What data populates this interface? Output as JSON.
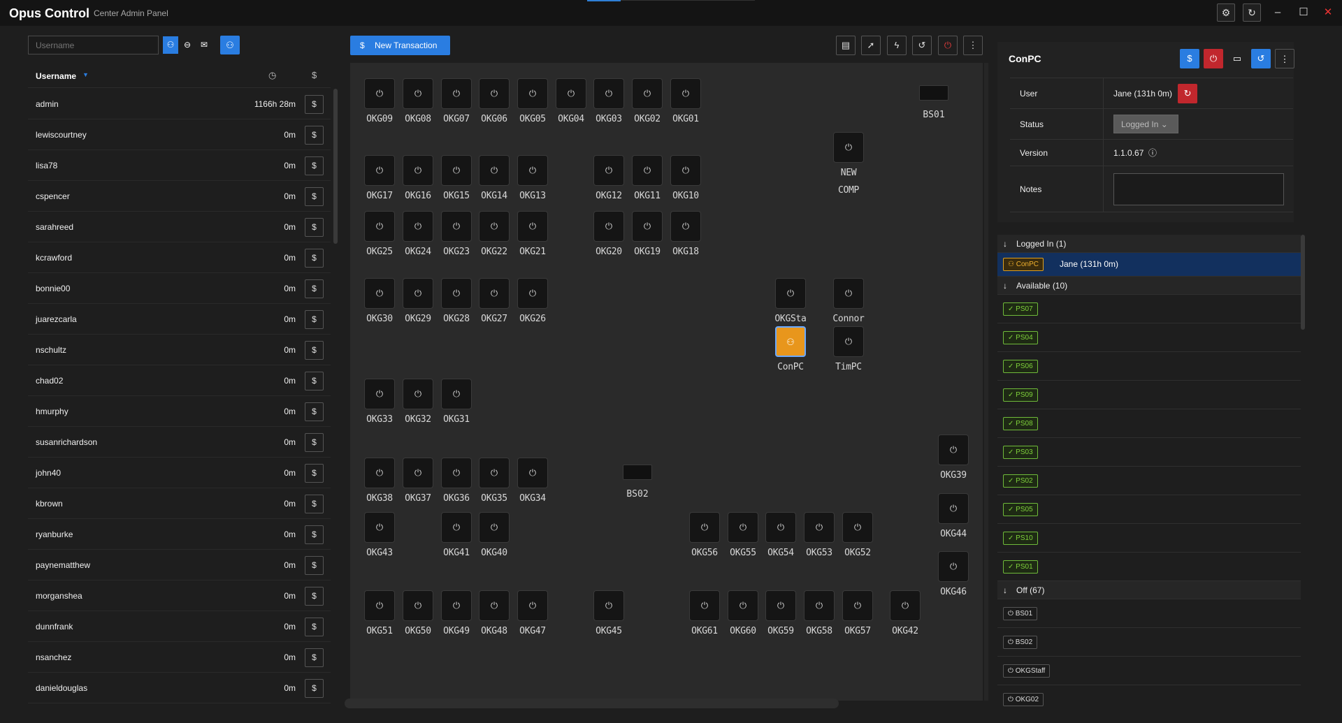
{
  "app": {
    "title": "Opus Control",
    "subtitle": "Center Admin Panel"
  },
  "left": {
    "search_placeholder": "Username",
    "header_label": "Username",
    "users": [
      {
        "name": "admin",
        "time": "1166h 28m"
      },
      {
        "name": "lewiscourtney",
        "time": "0m"
      },
      {
        "name": "lisa78",
        "time": "0m"
      },
      {
        "name": "cspencer",
        "time": "0m"
      },
      {
        "name": "sarahreed",
        "time": "0m"
      },
      {
        "name": "kcrawford",
        "time": "0m"
      },
      {
        "name": "bonnie00",
        "time": "0m"
      },
      {
        "name": "juarezcarla",
        "time": "0m"
      },
      {
        "name": "nschultz",
        "time": "0m"
      },
      {
        "name": "chad02",
        "time": "0m"
      },
      {
        "name": "hmurphy",
        "time": "0m"
      },
      {
        "name": "susanrichardson",
        "time": "0m"
      },
      {
        "name": "john40",
        "time": "0m"
      },
      {
        "name": "kbrown",
        "time": "0m"
      },
      {
        "name": "ryanburke",
        "time": "0m"
      },
      {
        "name": "paynematthew",
        "time": "0m"
      },
      {
        "name": "morganshea",
        "time": "0m"
      },
      {
        "name": "dunnfrank",
        "time": "0m"
      },
      {
        "name": "nsanchez",
        "time": "0m"
      },
      {
        "name": "danieldouglas",
        "time": "0m"
      }
    ]
  },
  "toolbar": {
    "new_transaction": "New Transaction"
  },
  "map": {
    "computers": [
      {
        "label": "OKG09"
      },
      {
        "label": "OKG08"
      },
      {
        "label": "OKG07"
      },
      {
        "label": "OKG06"
      },
      {
        "label": "OKG05"
      },
      {
        "label": "OKG04"
      },
      {
        "label": "OKG03"
      },
      {
        "label": "OKG02"
      },
      {
        "label": "OKG01"
      },
      {
        "label": "OKG17"
      },
      {
        "label": "OKG16"
      },
      {
        "label": "OKG15"
      },
      {
        "label": "OKG14"
      },
      {
        "label": "OKG13"
      },
      {
        "label": "OKG12"
      },
      {
        "label": "OKG11"
      },
      {
        "label": "OKG10"
      },
      {
        "label": "OKG25"
      },
      {
        "label": "OKG24"
      },
      {
        "label": "OKG23"
      },
      {
        "label": "OKG22"
      },
      {
        "label": "OKG21"
      },
      {
        "label": "OKG20"
      },
      {
        "label": "OKG19"
      },
      {
        "label": "OKG18"
      },
      {
        "label": "OKG30"
      },
      {
        "label": "OKG29"
      },
      {
        "label": "OKG28"
      },
      {
        "label": "OKG27"
      },
      {
        "label": "OKG26"
      },
      {
        "label": "OKG33"
      },
      {
        "label": "OKG32"
      },
      {
        "label": "OKG31"
      },
      {
        "label": "OKG38"
      },
      {
        "label": "OKG37"
      },
      {
        "label": "OKG36"
      },
      {
        "label": "OKG35"
      },
      {
        "label": "OKG34"
      },
      {
        "label": "OKG43"
      },
      {
        "label": "OKG41"
      },
      {
        "label": "OKG40"
      },
      {
        "label": "OKG51"
      },
      {
        "label": "OKG50"
      },
      {
        "label": "OKG49"
      },
      {
        "label": "OKG48"
      },
      {
        "label": "OKG47"
      },
      {
        "label": "OKG45"
      },
      {
        "label": "OKG56"
      },
      {
        "label": "OKG55"
      },
      {
        "label": "OKG54"
      },
      {
        "label": "OKG53"
      },
      {
        "label": "OKG52"
      },
      {
        "label": "OKG61"
      },
      {
        "label": "OKG60"
      },
      {
        "label": "OKG59"
      },
      {
        "label": "OKG58"
      },
      {
        "label": "OKG57"
      },
      {
        "label": "OKG42"
      },
      {
        "label": "OKG39"
      },
      {
        "label": "OKG44"
      },
      {
        "label": "OKG46"
      },
      {
        "label": "NEW COMP"
      },
      {
        "label": "OKGSta"
      },
      {
        "label": "Connor"
      },
      {
        "label": "ConPC"
      },
      {
        "label": "TimPC"
      }
    ],
    "stations": [
      {
        "label": "BS01"
      },
      {
        "label": "BS02"
      }
    ]
  },
  "detail": {
    "title": "ConPC",
    "user_label": "User",
    "user_value": "Jane   (131h 0m)",
    "status_label": "Status",
    "status_value": "Logged In",
    "version_label": "Version",
    "version_value": "1.1.0.67",
    "notes_label": "Notes"
  },
  "list": {
    "logged_in_header": "Logged In (1)",
    "logged_in": [
      {
        "pc": "ConPC",
        "user": "Jane    (131h 0m)"
      }
    ],
    "available_header": "Available (10)",
    "available": [
      "PS07",
      "PS04",
      "PS06",
      "PS09",
      "PS08",
      "PS03",
      "PS02",
      "PS05",
      "PS10",
      "PS01"
    ],
    "off_header": "Off (67)",
    "off": [
      "BS01",
      "BS02",
      "OKGStaff",
      "OKG02"
    ]
  },
  "colors": {
    "accent": "#2a7de1",
    "danger": "#c1272d",
    "active_pc": "#e8961c",
    "available": "#7fd13b"
  }
}
